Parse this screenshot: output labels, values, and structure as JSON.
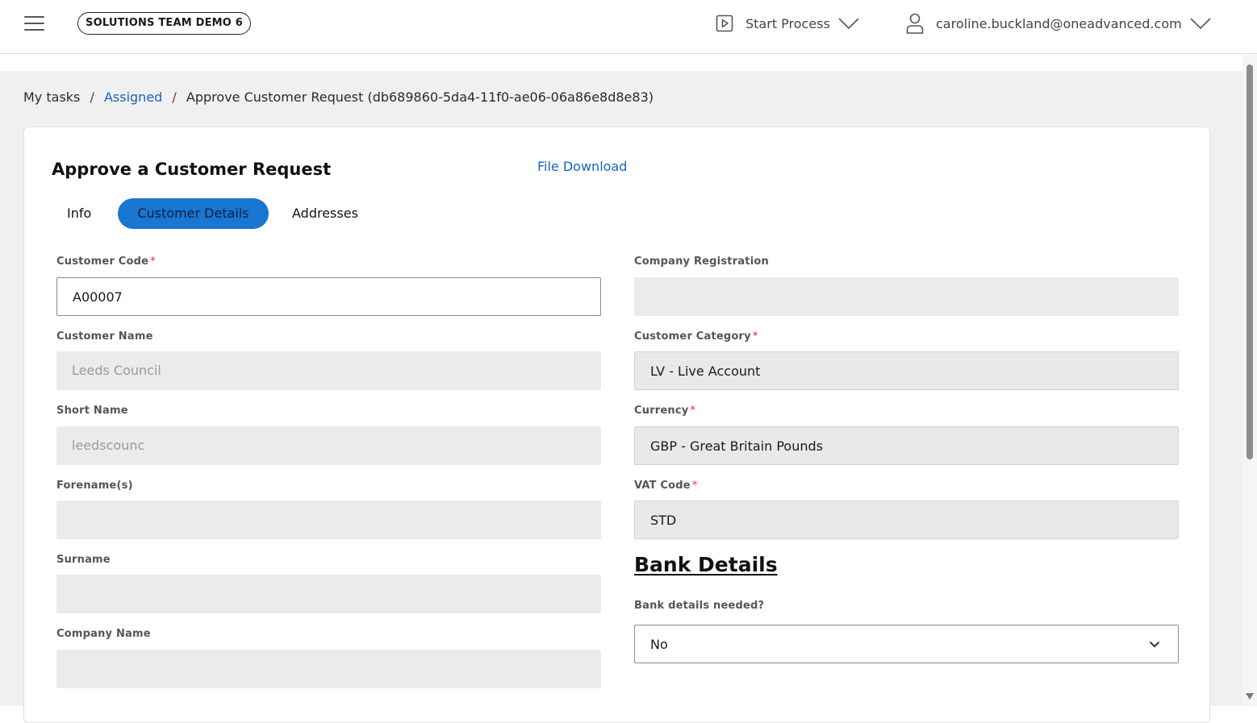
{
  "header": {
    "tenant": "SOLUTIONS TEAM DEMO 6",
    "start_process_label": "Start Process",
    "user_email": "caroline.buckland@oneadvanced.com"
  },
  "breadcrumb": {
    "root": "My tasks",
    "separator": "/",
    "parent": "Assigned",
    "current": "Approve Customer Request (db689860-5da4-11f0-ae06-06a86e8d8e83)"
  },
  "form": {
    "title": "Approve a Customer Request",
    "file_download": "File Download",
    "tabs": [
      {
        "label": "Info",
        "active": false
      },
      {
        "label": "Customer Details",
        "active": true
      },
      {
        "label": "Addresses",
        "active": false
      }
    ],
    "left_fields": [
      {
        "label": "Customer Code",
        "required": true,
        "value": "A00007",
        "state": "editable"
      },
      {
        "label": "Customer Name",
        "required": false,
        "value": "Leeds Council",
        "state": "readonly"
      },
      {
        "label": "Short Name",
        "required": false,
        "value": "leedscounc",
        "state": "readonly"
      },
      {
        "label": "Forename(s)",
        "required": false,
        "value": "",
        "state": "readonly"
      },
      {
        "label": "Surname",
        "required": false,
        "value": "",
        "state": "readonly"
      },
      {
        "label": "Company Name",
        "required": false,
        "value": "",
        "state": "readonly"
      }
    ],
    "right_fields": [
      {
        "label": "Company Registration",
        "required": false,
        "value": "",
        "state": "readonly"
      },
      {
        "label": "Customer Category",
        "required": true,
        "value": "LV - Live Account",
        "state": "select-readonly"
      },
      {
        "label": "Currency",
        "required": true,
        "value": "GBP - Great Britain Pounds",
        "state": "select-readonly"
      },
      {
        "label": "VAT Code",
        "required": true,
        "value": "STD",
        "state": "select-readonly"
      }
    ],
    "required_marker": "*",
    "bank": {
      "heading": "Bank Details",
      "question": "Bank details needed?",
      "selected": "No"
    }
  },
  "colors": {
    "accent": "#1976d2",
    "link": "#1565c0",
    "required": "#d32f2f",
    "page_background": "#f0f0f1",
    "readonly_field": "#ebebec"
  },
  "icons": {
    "menu": "hamburger-icon",
    "start_process": "play-square-icon",
    "user": "user-icon",
    "chevron": "chevron-down-icon"
  }
}
